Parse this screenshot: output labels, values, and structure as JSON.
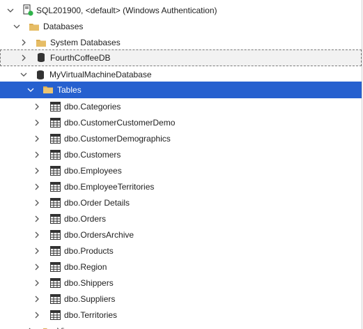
{
  "tree": {
    "server": {
      "label": "SQL201900, <default> (Windows Authentication)",
      "icon": "server-connected-icon",
      "status_color": "#2fb34a",
      "expanded": true
    },
    "databases_folder": {
      "label": "Databases",
      "icon": "folder-icon",
      "expanded": true
    },
    "system_databases": {
      "label": "System Databases",
      "icon": "folder-icon",
      "expanded": false
    },
    "fourth_coffee": {
      "label": "FourthCoffeeDB",
      "icon": "database-icon",
      "expanded": false,
      "focused": true
    },
    "my_vm_db": {
      "label": "MyVirtualMachineDatabase",
      "icon": "database-icon",
      "expanded": true
    },
    "tables_folder": {
      "label": "Tables",
      "icon": "folder-icon",
      "expanded": true,
      "selected": true
    },
    "tables": [
      "dbo.Categories",
      "dbo.CustomerCustomerDemo",
      "dbo.CustomerDemographics",
      "dbo.Customers",
      "dbo.Employees",
      "dbo.EmployeeTerritories",
      "dbo.Order Details",
      "dbo.Orders",
      "dbo.OrdersArchive",
      "dbo.Products",
      "dbo.Region",
      "dbo.Shippers",
      "dbo.Suppliers",
      "dbo.Territories"
    ],
    "partial_next": {
      "label": "Vi",
      "icon": "folder-icon"
    }
  },
  "colors": {
    "selection": "#2660cf",
    "folder": "#d9a640",
    "chevron": "#555555"
  }
}
